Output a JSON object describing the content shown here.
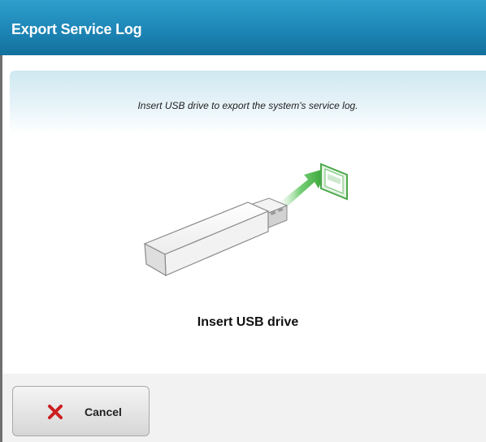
{
  "window": {
    "title": "Export Service Log"
  },
  "main": {
    "instruction": "Insert USB drive to export the system's service log.",
    "status": "Insert USB drive",
    "illustration_icon": "usb-drive-insert-illustration"
  },
  "footer": {
    "cancel_label": "Cancel",
    "cancel_icon": "close-x-icon"
  },
  "colors": {
    "header_blue": "#1d86b6",
    "cancel_x_red": "#cc1f1f",
    "arrow_green": "#3cae3c"
  }
}
